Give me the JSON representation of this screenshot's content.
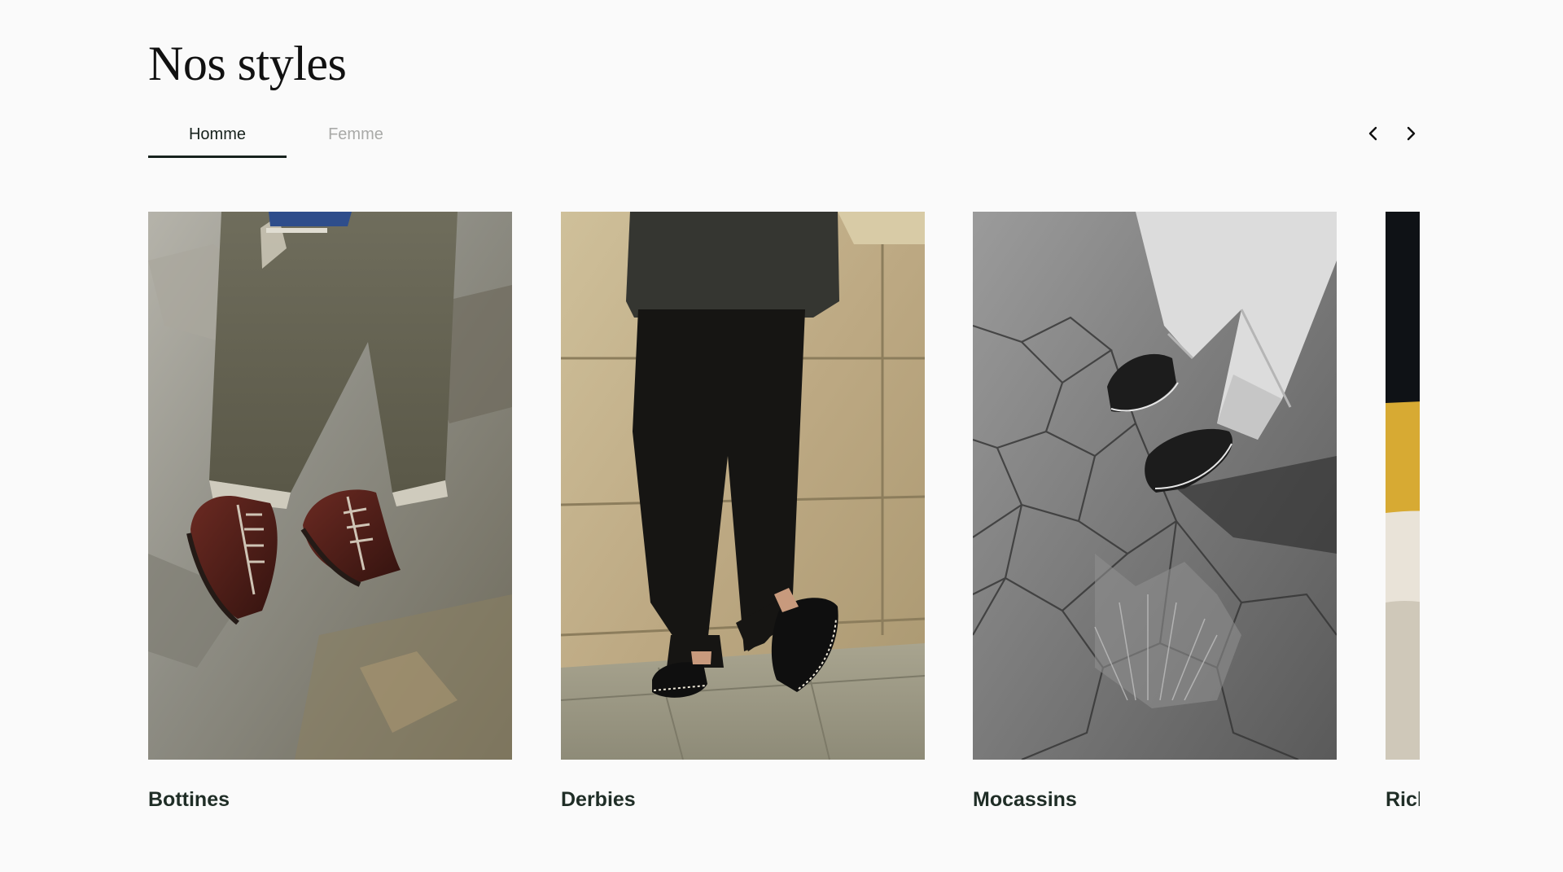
{
  "section": {
    "title": "Nos styles"
  },
  "tabs": [
    {
      "label": "Homme",
      "active": true
    },
    {
      "label": "Femme",
      "active": false
    }
  ],
  "carousel": {
    "prev_icon": "chevron-left-icon",
    "next_icon": "chevron-right-icon",
    "items": [
      {
        "label": "Bottines",
        "image": "hiking-boots-photo"
      },
      {
        "label": "Derbies",
        "image": "derby-shoes-photo"
      },
      {
        "label": "Mocassins",
        "image": "loafers-photo"
      },
      {
        "label": "Richelieu",
        "image": "oxford-shoes-photo"
      }
    ]
  },
  "colors": {
    "background": "#fafafa",
    "text_dark": "#17221d",
    "tab_inactive": "#a9aaa8"
  }
}
